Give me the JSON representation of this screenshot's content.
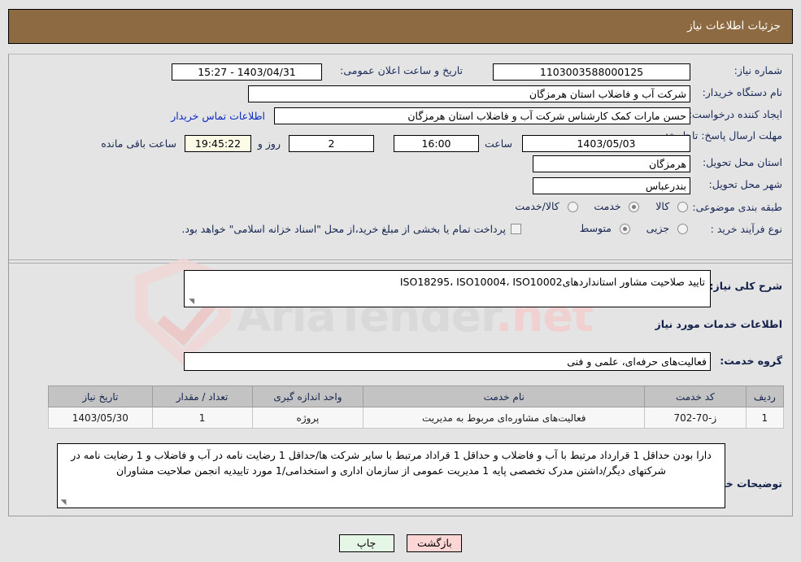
{
  "header": {
    "title": "جزئیات اطلاعات نیاز"
  },
  "form": {
    "need_number_label": "شماره نیاز:",
    "need_number_value": "1103003588000125",
    "announce_datetime_label": "تاریخ و ساعت اعلان عمومی:",
    "announce_datetime_value": "1403/04/31 - 15:27",
    "buyer_org_label": "نام دستگاه خریدار:",
    "buyer_org_value": "شرکت آب و فاضلاب استان هرمزگان",
    "creator_label": "ایجاد کننده درخواست:",
    "creator_value": "حسن مارات کمک کارشناس شرکت آب و فاضلاب استان هرمزگان",
    "contact_link": "اطلاعات تماس خریدار",
    "deadline_label": "مهلت ارسال پاسخ: تا تاریخ:",
    "deadline_date": "1403/05/03",
    "hour_label": "ساعت",
    "deadline_time": "16:00",
    "remaining_days": "2",
    "days_and_label": "روز و",
    "remaining_time": "19:45:22",
    "remaining_suffix": "ساعت باقی مانده",
    "province_label": "استان محل تحویل:",
    "province_value": "هرمزگان",
    "city_label": "شهر محل تحویل:",
    "city_value": "بندرعباس",
    "category_label": "طبقه بندی موضوعی:",
    "category_options": [
      {
        "label": "کالا",
        "selected": false
      },
      {
        "label": "خدمت",
        "selected": true
      },
      {
        "label": "کالا/خدمت",
        "selected": false
      }
    ],
    "purchase_type_label": "نوع فرآیند خرید :",
    "purchase_options": [
      {
        "label": "جزیی",
        "selected": false
      },
      {
        "label": "متوسط",
        "selected": true
      }
    ],
    "treasury_note": "پرداخت تمام یا بخشی از مبلغ خرید،از محل \"اسناد خزانه اسلامی\" خواهد بود."
  },
  "description": {
    "label": "شرح کلی نیاز:",
    "value": "تایید صلاحیت مشاور استانداردهایISO18295، ISO10004، ISO10002"
  },
  "services_section": {
    "title": "اطلاعات خدمات مورد نیاز",
    "group_label": "گروه خدمت:",
    "group_value": "فعالیت‌های حرفه‌ای، علمی و فنی"
  },
  "table": {
    "headers": [
      "ردیف",
      "کد خدمت",
      "نام خدمت",
      "واحد اندازه گیری",
      "تعداد / مقدار",
      "تاریخ نیاز"
    ],
    "rows": [
      {
        "index": "1",
        "code": "ز-70-702",
        "name": "فعالیت‌های مشاوره‌ای مربوط به مدیریت",
        "unit": "پروژه",
        "quantity": "1",
        "need_date": "1403/05/30"
      }
    ]
  },
  "buyer_notes": {
    "label": "توضیحات خریدار:",
    "value": "دارا بودن حداقل 1 قرارداد مرتبط با آب و فاضلاب و حداقل 1 قراداد مرتبط با سایر شرکت ها/حداقل 1 رضایت نامه در آب و فاضلاب و 1 رضایت نامه در شرکتهای دیگر/داشتن مدرک تخصصی پایه 1 مدیریت عمومی از سازمان اداری و استخدامی/1 مورد تاییدیه انجمن صلاحیت مشاوران"
  },
  "footer": {
    "back_label": "بازگشت",
    "print_label": "چاپ"
  },
  "watermark": {
    "text_part1": "AriaTender",
    "text_part2": ".net"
  },
  "colors": {
    "header_bg": "#8d6a41",
    "page_bg": "#e4e4e4",
    "label": "#1b2a5a",
    "link": "#0b29c4",
    "back_btn": "#fcd5d5",
    "print_btn": "#e6f6e6",
    "timer_bg": "#fbfbe6",
    "table_header": "#c3c3c3"
  }
}
